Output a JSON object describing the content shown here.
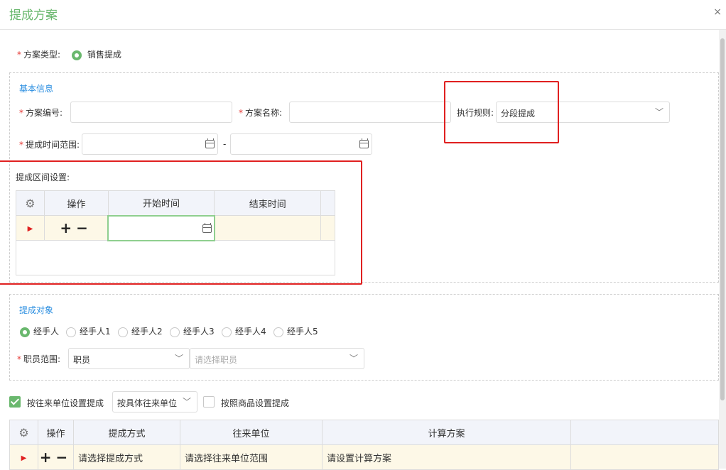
{
  "dialog": {
    "title": "提成方案",
    "close": "×"
  },
  "scheme_type": {
    "label": "方案类型:",
    "option": "销售提成"
  },
  "basic": {
    "title": "基本信息",
    "code_label": "方案编号:",
    "name_label": "方案名称:",
    "rule_label": "执行规则:",
    "rule_value": "分段提成",
    "date_label": "提成时间范围:",
    "date_sep": "-"
  },
  "interval": {
    "label": "提成区间设置:",
    "headers": [
      "操作",
      "开始时间",
      "结束时间"
    ],
    "ops": "+−"
  },
  "target": {
    "title": "提成对象",
    "options": [
      "经手人",
      "经手人1",
      "经手人2",
      "经手人3",
      "经手人4",
      "经手人5"
    ],
    "staff_label": "职员范围:",
    "staff_value": "职员",
    "staff_placeholder": "请选择职员"
  },
  "unit_settings": {
    "by_unit_label": "按往来单位设置提成",
    "unit_mode": "按具体往来单位",
    "by_goods_label": "按照商品设置提成"
  },
  "bottom_table": {
    "headers": [
      "操作",
      "提成方式",
      "往来单位",
      "计算方案"
    ],
    "ops": "+−",
    "placeholders": [
      "请选择提成方式",
      "请选择往来单位范围",
      "请设置计算方案"
    ]
  },
  "colors": {
    "accent": "#6ab86e",
    "link": "#2a8ee0",
    "highlight": "#e02020"
  }
}
